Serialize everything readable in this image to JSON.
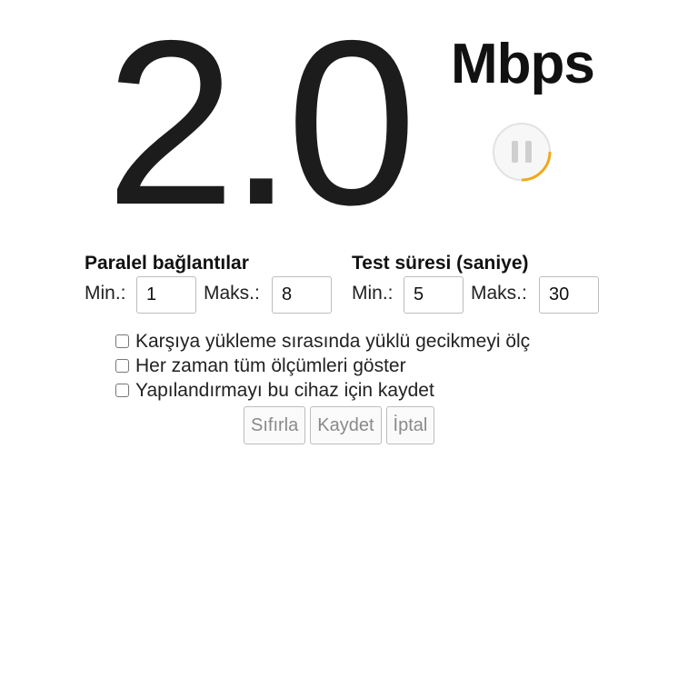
{
  "speed": {
    "value": "2.0",
    "unit": "Mbps"
  },
  "pause_control": {
    "icon": "pause-icon",
    "progress_color": "#f0a81c"
  },
  "parallel_connections": {
    "title": "Paralel bağlantılar",
    "min_label": "Min.:",
    "min_value": "1",
    "max_label": "Maks.:",
    "max_value": "8"
  },
  "test_duration": {
    "title": "Test süresi (saniye)",
    "min_label": "Min.:",
    "min_value": "5",
    "max_label": "Maks.:",
    "max_value": "30"
  },
  "options": [
    {
      "label": "Karşıya yükleme sırasında yüklü gecikmeyi ölç",
      "checked": false
    },
    {
      "label": "Her zaman tüm ölçümleri göster",
      "checked": false
    },
    {
      "label": "Yapılandırmayı bu cihaz için kaydet",
      "checked": false
    }
  ],
  "actions": {
    "reset": "Sıfırla",
    "save": "Kaydet",
    "cancel": "İptal"
  }
}
